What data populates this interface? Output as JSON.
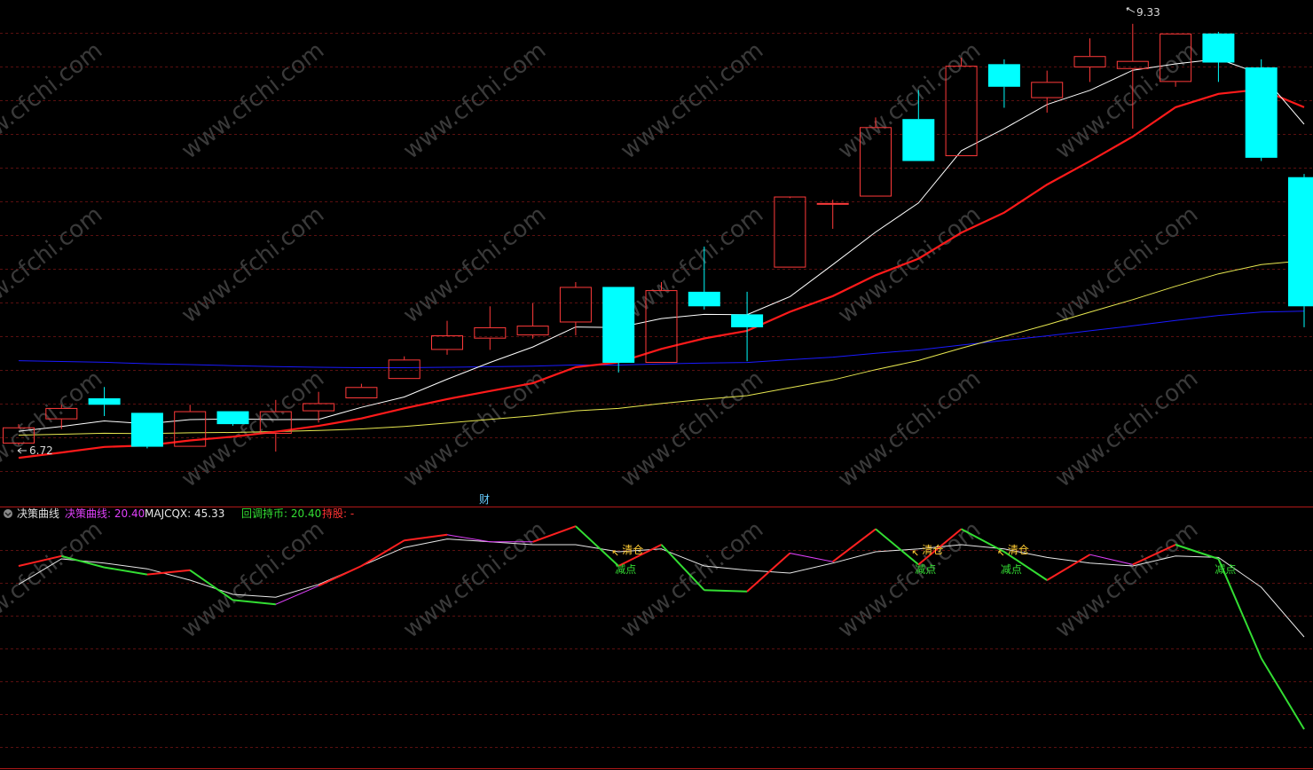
{
  "price_panel": {
    "high_label": "9.33",
    "low_label": "6.72",
    "event_marker": "财"
  },
  "indicator_panel": {
    "title": "决策曲线",
    "legend": [
      {
        "label": "决策曲线: 20.40",
        "color": "#e040fb"
      },
      {
        "label": "MAJCQX: 45.33",
        "color": "#e8e8e8"
      },
      {
        "label": "回调持币: 20.40",
        "color": "#33dd33"
      },
      {
        "label": "持股: -",
        "color": "#ff3333"
      }
    ],
    "signals": [
      {
        "label": "清仓",
        "type": "clear",
        "index": 14
      },
      {
        "label": "减点",
        "type": "reduce",
        "index": 14
      },
      {
        "label": "清仓",
        "type": "clear",
        "index": 21
      },
      {
        "label": "减点",
        "type": "reduce",
        "index": 21
      },
      {
        "label": "清仓",
        "type": "clear",
        "index": 23
      },
      {
        "label": "减点",
        "type": "reduce",
        "index": 23
      },
      {
        "label": "减点",
        "type": "reduce",
        "index": 28
      }
    ]
  },
  "watermark": "www.cfchi.com",
  "colors": {
    "background": "#000000",
    "up_candle": "#ff3a3a",
    "down_candle": "#00ffff",
    "ma_short": "#ffffff",
    "ma_mid": "#ff1a1a",
    "ma_long": "#e8e850",
    "ma_longest": "#1a1aff",
    "decision_curve": "#e040fb",
    "majcqx": "#e8e8e8",
    "pullback": "#33dd33",
    "hold": "#ff2020",
    "grid": "#5a1010",
    "signal_clear": "#ffcc33",
    "signal_reduce": "#33dd33"
  },
  "chart_data": [
    {
      "type": "candlestick",
      "price_range": [
        6.4,
        9.45
      ],
      "candles": [
        {
          "o": 6.73,
          "h": 6.85,
          "l": 6.72,
          "c": 6.83
        },
        {
          "o": 6.88,
          "h": 6.97,
          "l": 6.82,
          "c": 6.95
        },
        {
          "o": 7.01,
          "h": 7.08,
          "l": 6.9,
          "c": 6.97
        },
        {
          "o": 6.92,
          "h": 6.92,
          "l": 6.7,
          "c": 6.71
        },
        {
          "o": 6.71,
          "h": 6.97,
          "l": 6.71,
          "c": 6.93
        },
        {
          "o": 6.93,
          "h": 6.93,
          "l": 6.84,
          "c": 6.85
        },
        {
          "o": 6.79,
          "h": 7.0,
          "l": 6.68,
          "c": 6.93
        },
        {
          "o": 6.93,
          "h": 7.05,
          "l": 6.86,
          "c": 6.98
        },
        {
          "o": 7.01,
          "h": 7.1,
          "l": 7.01,
          "c": 7.08
        },
        {
          "o": 7.13,
          "h": 7.27,
          "l": 7.13,
          "c": 7.25
        },
        {
          "o": 7.31,
          "h": 7.49,
          "l": 7.28,
          "c": 7.4
        },
        {
          "o": 7.38,
          "h": 7.58,
          "l": 7.31,
          "c": 7.45
        },
        {
          "o": 7.4,
          "h": 7.6,
          "l": 7.38,
          "c": 7.46
        },
        {
          "o": 7.48,
          "h": 7.73,
          "l": 7.4,
          "c": 7.7
        },
        {
          "o": 7.7,
          "h": 7.7,
          "l": 7.17,
          "c": 7.23
        },
        {
          "o": 7.23,
          "h": 7.73,
          "l": 7.23,
          "c": 7.68
        },
        {
          "o": 7.67,
          "h": 7.95,
          "l": 7.56,
          "c": 7.58
        },
        {
          "o": 7.53,
          "h": 7.67,
          "l": 7.24,
          "c": 7.45
        },
        {
          "o": 7.82,
          "h": 8.25,
          "l": 7.82,
          "c": 8.26
        },
        {
          "o": 8.22,
          "h": 8.24,
          "l": 8.06,
          "c": 8.22
        },
        {
          "o": 8.26,
          "h": 8.75,
          "l": 8.26,
          "c": 8.69
        },
        {
          "o": 8.74,
          "h": 8.92,
          "l": 8.48,
          "c": 8.48
        },
        {
          "o": 8.51,
          "h": 9.12,
          "l": 8.51,
          "c": 9.07
        },
        {
          "o": 9.08,
          "h": 9.11,
          "l": 8.81,
          "c": 8.94
        },
        {
          "o": 8.87,
          "h": 9.04,
          "l": 8.78,
          "c": 8.97
        },
        {
          "o": 9.06,
          "h": 9.24,
          "l": 8.97,
          "c": 9.13
        },
        {
          "o": 9.05,
          "h": 9.33,
          "l": 8.68,
          "c": 9.1
        },
        {
          "o": 8.97,
          "h": 9.27,
          "l": 8.94,
          "c": 9.27
        },
        {
          "o": 9.27,
          "h": 9.28,
          "l": 8.97,
          "c": 9.09
        },
        {
          "o": 9.06,
          "h": 9.11,
          "l": 8.48,
          "c": 8.5
        },
        {
          "o": 8.38,
          "h": 8.4,
          "l": 7.45,
          "c": 7.58
        }
      ]
    },
    {
      "type": "line",
      "index_range": [
        0,
        30
      ],
      "y_range": [
        -100,
        70
      ],
      "series": [
        {
          "name": "决策曲线",
          "values": [
            40,
            47,
            39,
            34,
            37,
            16,
            13,
            26,
            40,
            58,
            62,
            57,
            57,
            68,
            40,
            55,
            23,
            22,
            49,
            43,
            66,
            41,
            66,
            50,
            30,
            48,
            41,
            55,
            45,
            -25,
            -75
          ]
        },
        {
          "name": "MAJCQX",
          "values": [
            27,
            45,
            42,
            38,
            30,
            20,
            18,
            27,
            40,
            53,
            59,
            57,
            55,
            55,
            50,
            52,
            40,
            37,
            35,
            42,
            50,
            52,
            55,
            52,
            46,
            42,
            40,
            47,
            46,
            25,
            -10
          ]
        }
      ]
    }
  ]
}
